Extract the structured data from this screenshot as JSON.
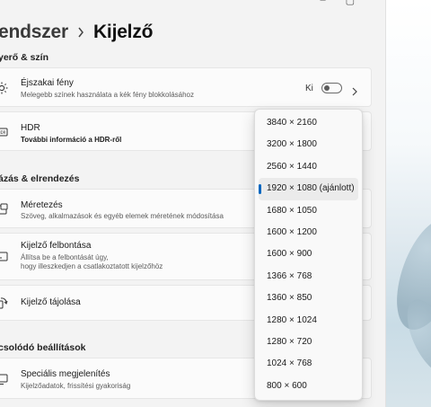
{
  "breadcrumb": {
    "parent": "endszer",
    "current": "Kijelző"
  },
  "sections": {
    "brightness_color": "yerő & szín",
    "scale_layout": "ázás & elrendezés",
    "related": "csolódó beállítások"
  },
  "night_light": {
    "title": "Éjszakai fény",
    "desc": "Melegebb színek használata a kék fény blokkolásához",
    "toggle_state": "Ki",
    "toggle_on": false
  },
  "hdr": {
    "title": "HDR",
    "desc": "További információ a HDR-ről"
  },
  "scale": {
    "title": "Méretezés",
    "desc": "Szöveg, alkalmazások és egyéb elemek méretének módosítása"
  },
  "resolution": {
    "title": "Kijelző felbontása",
    "desc_line1": "Állítsa be a felbontását úgy,",
    "desc_line2": "hogy illeszkedjen a csatlakoztatott kijelzőhöz"
  },
  "orientation": {
    "title": "Kijelző tájolása"
  },
  "advanced": {
    "title": "Speciális megjelenítés",
    "desc": "Kijelzőadatok, frissítési gyakoriság"
  },
  "resolution_options": [
    "3840 × 2160",
    "3200 × 1800",
    "2560 × 1440",
    "1920 × 1080 (ajánlott)",
    "1680 × 1050",
    "1600 × 1200",
    "1600 × 900",
    "1366 × 768",
    "1360 × 850",
    "1280 × 1024",
    "1280 × 720",
    "1024 × 768",
    "800 × 600"
  ],
  "selected_option": "1920 × 1080 (ajánlott)",
  "accent_color": "#0067c0",
  "icons": {
    "night_light": "sun-icon",
    "hdr": "hdr-icon",
    "scale": "scale-icon",
    "resolution": "resolution-icon",
    "orientation": "orientation-icon",
    "advanced": "monitor-icon"
  }
}
